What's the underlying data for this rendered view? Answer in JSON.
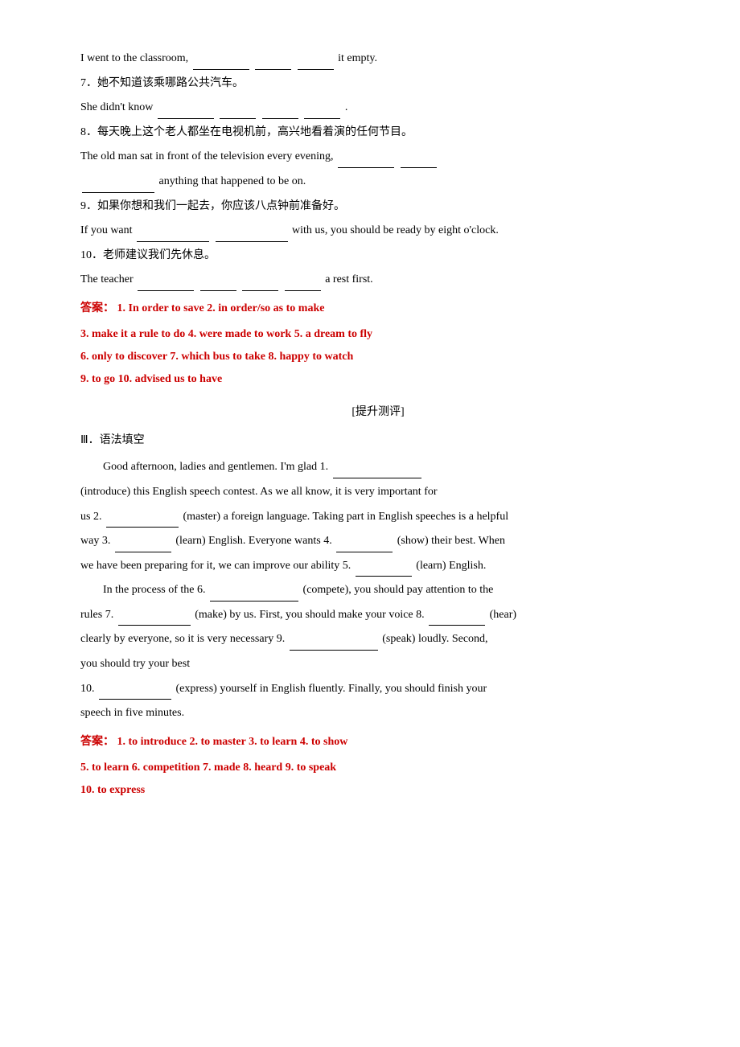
{
  "page": {
    "intro_line": "I went to the classroom,",
    "intro_end": "it empty.",
    "q7_chinese": "7．她不知道该乘哪路公共汽车。",
    "q7_english_start": "She didn't know",
    "q7_english_end": ".",
    "q8_chinese": "8．每天晚上这个老人都坐在电视机前，高兴地看着演的任何节目。",
    "q8_english_start": "The old man sat in front of the television every evening,",
    "q8_english_mid": "anything that happened to be on.",
    "q9_chinese": "9．如果你想和我们一起去，你应该八点钟前准备好。",
    "q9_english_start": "If you want",
    "q9_english_end": "with us, you should be ready by eight o'clock.",
    "q10_chinese": "10．老师建议我们先休息。",
    "q10_english_start": "The teacher",
    "q10_english_end": "a rest first.",
    "answer_label": "答案：",
    "answer_line1": "1. In order to save  2. in order/so as to make",
    "answer_line2": "3. make it a rule to do  4. were made to work   5. a dream to fly",
    "answer_line3": "6. only to discover  7. which bus to take   8. happy to watch",
    "answer_line4": "9. to go   10. advised us to have",
    "section_bracket": "[提升测评]",
    "section3_header": "Ⅲ．语法填空",
    "para1_start": "Good afternoon, ladies and gentlemen. I'm glad 1.",
    "para1_word": "(introduce)",
    "para1_end": "this English speech contest. As we all know, it is very important for",
    "para2_start": "us 2.",
    "para2_word": "(master)",
    "para2_end": "a foreign language. Taking part in English speeches is a helpful",
    "para3_start": "way 3.",
    "para3_word": "(learn)",
    "para3_mid": "English. Everyone wants 4.",
    "para3_word2": "(show)",
    "para3_end": "their best. When",
    "para4_start": "we have been preparing for it, we can improve our ability 5.",
    "para4_word": "(learn)",
    "para4_end": "English.",
    "para5_start": "In the process of the 6.",
    "para5_word": "(compete),",
    "para5_end": "you should pay attention to the",
    "para6_start": "rules 7.",
    "para6_word": "(make)",
    "para6_mid": "by us. First, you should make your voice 8.",
    "para6_word2": "(hear)",
    "para7_start": "clearly by everyone, so it is very necessary 9.",
    "para7_word": "(speak)",
    "para7_end": "loudly. Second,",
    "para8": "you should try your best",
    "para9_start": "10.",
    "para9_word": "(express)",
    "para9_end": "yourself in English fluently. Finally, you should finish your",
    "para10": "speech in five minutes.",
    "answer2_label": "答案：",
    "answer2_line1": "1. to introduce  2. to master  3. to learn  4. to show",
    "answer2_line2": "5. to learn  6. competition  7. made  8. heard   9. to speak",
    "answer2_line3": "10. to express"
  }
}
